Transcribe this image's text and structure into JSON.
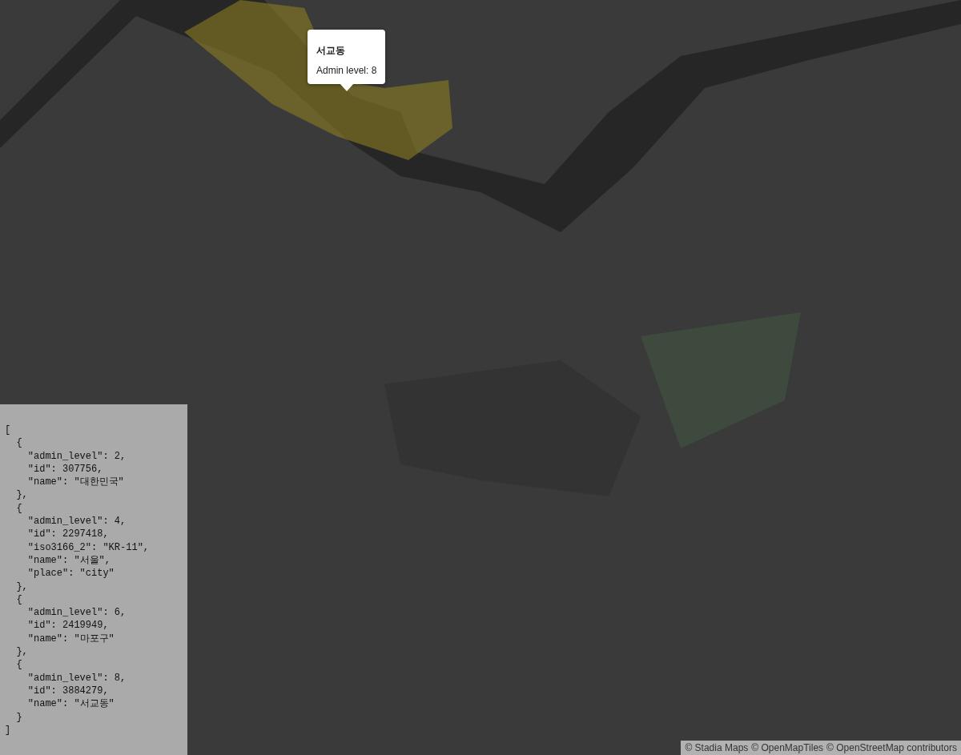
{
  "popup": {
    "title": "서교동",
    "text": "Admin level: 8"
  },
  "features_panel": {
    "lines": [
      "[",
      "  {",
      "    \"admin_level\": 2,",
      "    \"id\": 307756,",
      "    \"name\": \"대한민국\"",
      "  },",
      "  {",
      "    \"admin_level\": 4,",
      "    \"id\": 2297418,",
      "    \"iso3166_2\": \"KR-11\",",
      "    \"name\": \"서울\",",
      "    \"place\": \"city\"",
      "  },",
      "  {",
      "    \"admin_level\": 6,",
      "    \"id\": 2419949,",
      "    \"name\": \"마포구\"",
      "  },",
      "  {",
      "    \"admin_level\": 8,",
      "    \"id\": 3884279,",
      "    \"name\": \"서교동\"",
      "  }",
      "]"
    ]
  },
  "attribution": [
    "© Stadia Maps",
    "© OpenMapTiles",
    "© OpenStreetMap contributors"
  ]
}
